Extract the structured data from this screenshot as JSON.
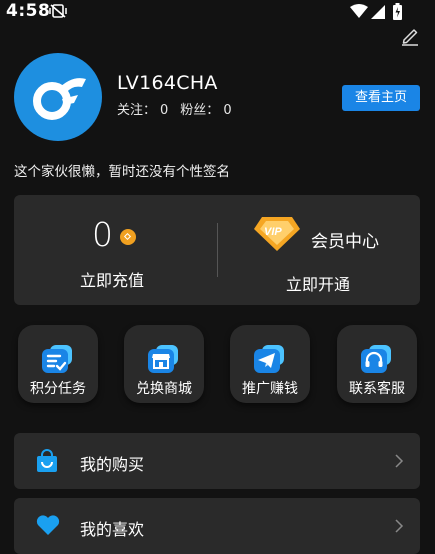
{
  "status_bar": {
    "time": "4:58",
    "icons": [
      "vibrate-icon",
      "wifi-icon",
      "signal-icon",
      "battery-icon"
    ]
  },
  "profile": {
    "username": "LV164CHA",
    "following_label": "关注：",
    "following_count": "0",
    "followers_label": "粉丝：",
    "followers_count": "0",
    "home_button": "查看主页",
    "bio": "这个家伙很懒，暂时还没有个性签名"
  },
  "wallet": {
    "balance": "0",
    "recharge_label": "立即充值",
    "vip_badge": "VIP",
    "vip_title": "会员中心",
    "vip_action": "立即开通"
  },
  "quick_actions": [
    {
      "label": "积分任务",
      "icon": "task-list-icon"
    },
    {
      "label": "兑换商城",
      "icon": "shop-icon"
    },
    {
      "label": "推广赚钱",
      "icon": "telegram-icon"
    },
    {
      "label": "联系客服",
      "icon": "headset-icon"
    }
  ],
  "menu": [
    {
      "label": "我的购买",
      "icon": "shopping-bag-icon"
    },
    {
      "label": "我的喜欢",
      "icon": "heart-icon"
    }
  ],
  "colors": {
    "background": "#121212",
    "card": "#2a2a2a",
    "accent": "#1a85e6",
    "coin": "#f0a020"
  }
}
